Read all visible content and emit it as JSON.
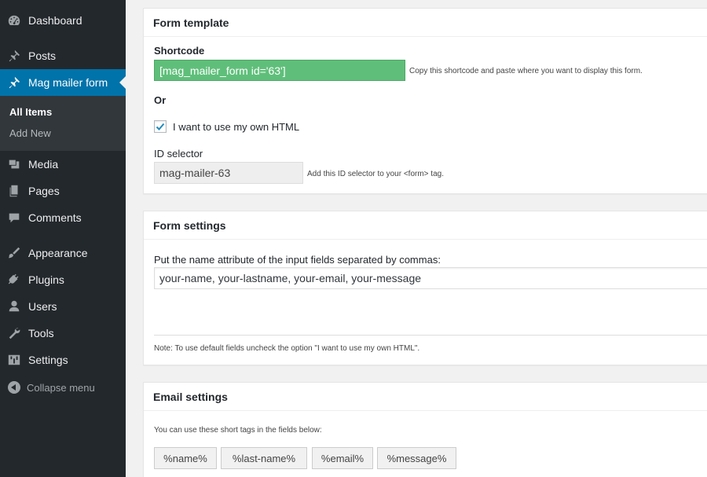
{
  "sidebar": {
    "items": [
      {
        "label": "Dashboard",
        "icon": "dashboard-icon"
      },
      {
        "label": "Posts",
        "icon": "pin-icon"
      },
      {
        "label": "Mag mailer form",
        "icon": "pin-icon",
        "active": true
      },
      {
        "label": "Media",
        "icon": "media-icon"
      },
      {
        "label": "Pages",
        "icon": "pages-icon"
      },
      {
        "label": "Comments",
        "icon": "comment-icon"
      },
      {
        "label": "Appearance",
        "icon": "brush-icon"
      },
      {
        "label": "Plugins",
        "icon": "plugin-icon"
      },
      {
        "label": "Users",
        "icon": "user-icon"
      },
      {
        "label": "Tools",
        "icon": "wrench-icon"
      },
      {
        "label": "Settings",
        "icon": "settings-icon"
      }
    ],
    "submenu": {
      "all_items": "All Items",
      "add_new": "Add New"
    },
    "collapse": "Collapse menu",
    "accent": "#0073aa",
    "background": "#23282d"
  },
  "form_template": {
    "title": "Form template",
    "shortcode_label": "Shortcode",
    "shortcode_value": "[mag_mailer_form id='63']",
    "shortcode_hint": "Copy this shortcode and paste where you want to display this form.",
    "or_label": "Or",
    "own_html_label": "I want to use my own HTML",
    "own_html_checked": true,
    "id_selector_label": "ID selector",
    "id_selector_value": "mag-mailer-63",
    "id_selector_hint": "Add this ID selector to your <form> tag.",
    "shortcode_color": "#5fbf7a"
  },
  "form_settings": {
    "title": "Form settings",
    "fields_label": "Put the name attribute of the input fields separated by commas:",
    "fields_value": "your-name, your-lastname, your-email, your-message",
    "note": "Note: To use default fields uncheck the option \"I want to use my own HTML\"."
  },
  "email_settings": {
    "title": "Email settings",
    "tags_hint": "You can use these short tags in the fields below:",
    "tags": [
      "%name%",
      "%last-name%",
      "%email%",
      "%message%"
    ]
  }
}
